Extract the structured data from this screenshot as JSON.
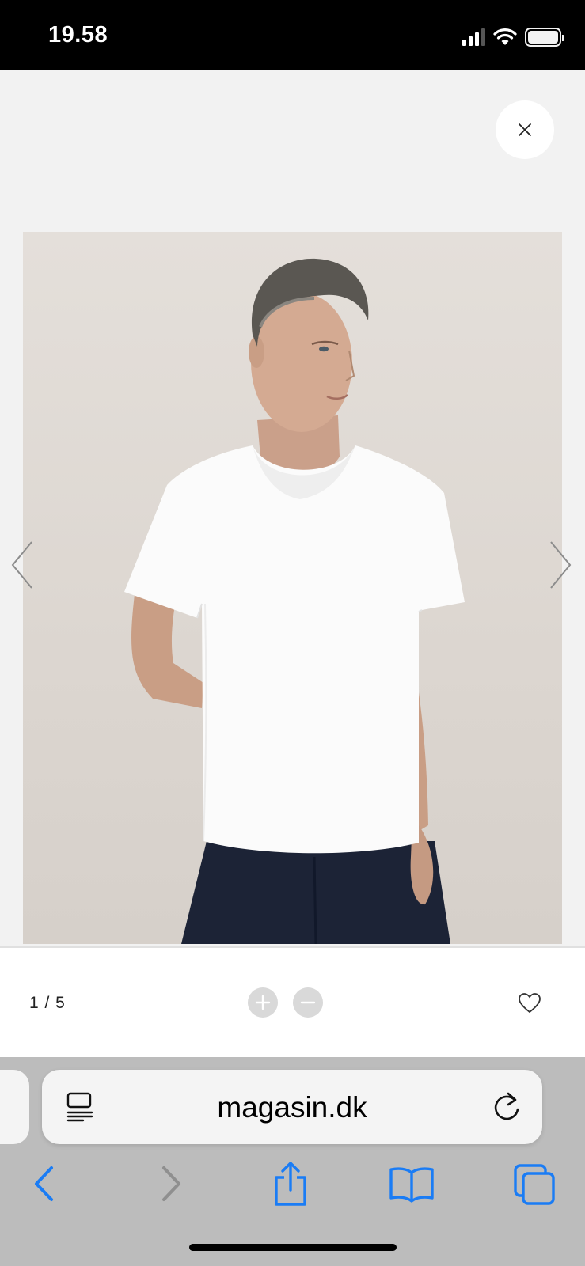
{
  "status_bar": {
    "time": "19.58",
    "icons": [
      "cellular-signal-icon",
      "wifi-icon",
      "battery-icon"
    ]
  },
  "gallery": {
    "close_icon": "close-icon",
    "image_alt": "Man wearing white V-neck t-shirt and dark jeans",
    "prev_icon": "chevron-left-icon",
    "next_icon": "chevron-right-icon",
    "counter": "1 / 5",
    "zoom_in_icon": "plus-icon",
    "zoom_out_icon": "minus-icon",
    "favorite_icon": "heart-icon"
  },
  "browser": {
    "url": "magasin.dk",
    "reader_icon": "reader-mode-icon",
    "reload_icon": "reload-icon",
    "toolbar": [
      "back-icon",
      "forward-icon",
      "share-icon",
      "bookmarks-icon",
      "tabs-icon"
    ],
    "accent_color": "#1a7cf5"
  }
}
